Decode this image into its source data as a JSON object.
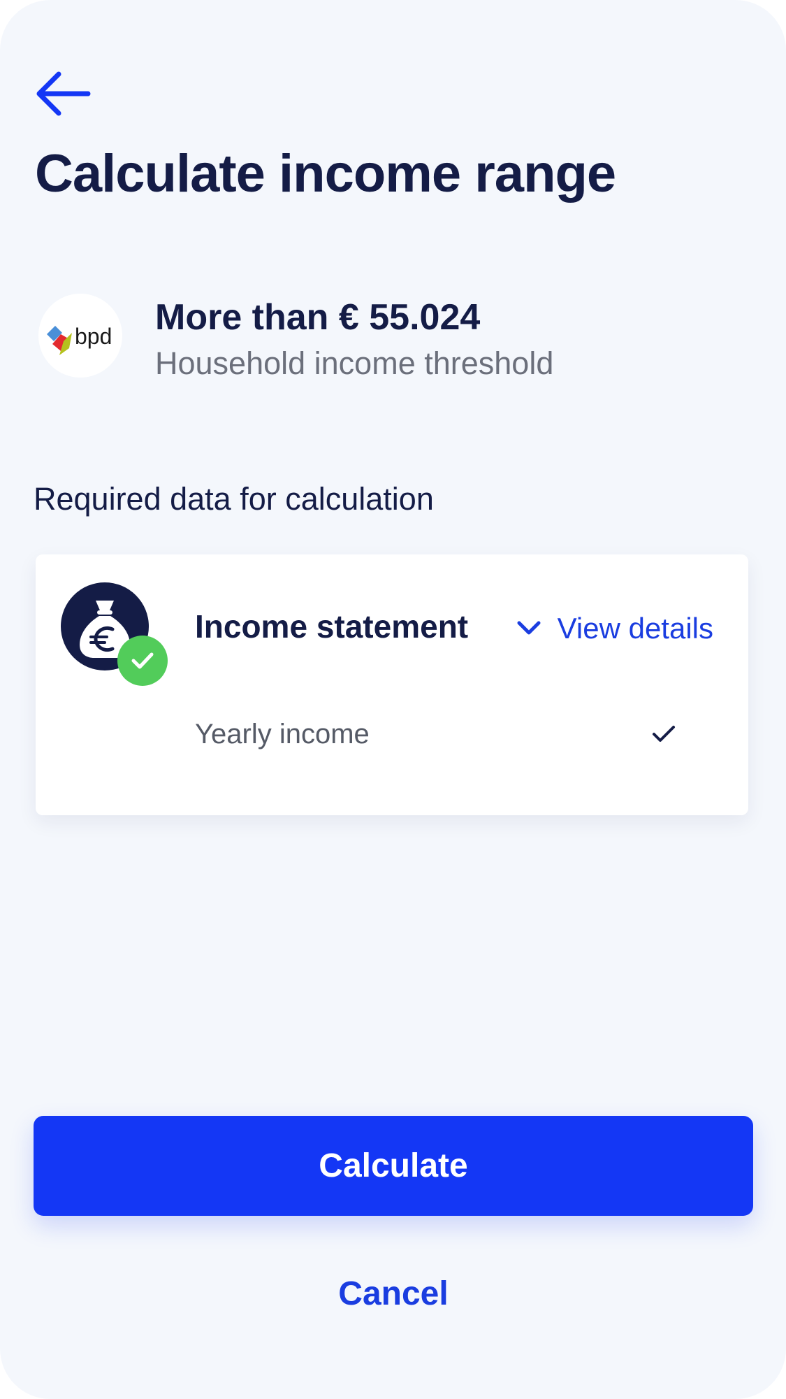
{
  "header": {
    "back_icon": "arrow-left-icon",
    "title": "Calculate income range"
  },
  "provider": {
    "logo_text": "bpd",
    "threshold_value": "More than € 55.024",
    "threshold_caption": "Household income threshold"
  },
  "required_data": {
    "section_title": "Required data for calculation",
    "card": {
      "icon": "money-bag-euro-icon",
      "status_icon": "check-circle-icon",
      "title": "Income statement",
      "details_icon": "chevron-down-icon",
      "details_label": "View details",
      "items": [
        {
          "label": "Yearly income",
          "status_icon": "check-icon"
        }
      ]
    }
  },
  "actions": {
    "calculate_label": "Calculate",
    "cancel_label": "Cancel"
  },
  "colors": {
    "background": "#f4f7fc",
    "navy": "#141c46",
    "primary_blue": "#1437f5",
    "link_blue": "#1a3de0",
    "success_green": "#52cc5a",
    "muted_text": "#6b6f7b"
  }
}
